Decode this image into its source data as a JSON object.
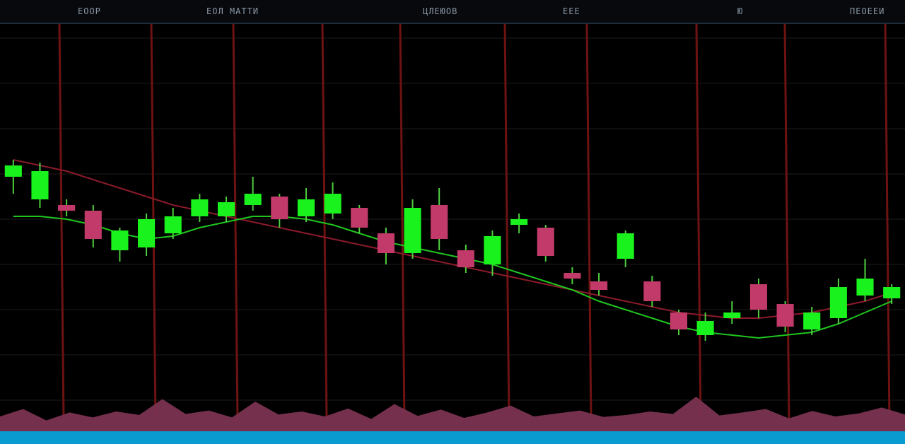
{
  "header": {
    "labels": [
      "ЕООР",
      "ЕОЛ МАТТИ",
      "ЦЛЕЮОВ",
      "ЕЕЕ",
      "Ю",
      "ПЕОЕЕИ"
    ]
  },
  "colors": {
    "background": "#000000",
    "bull": "#19f21c",
    "bear": "#c23a6a",
    "wick": "#4fd03f",
    "ma_fast": "#8b1a2b",
    "ma_slow": "#1fc51f",
    "volume": "#7a3350",
    "vline": "#6e1212",
    "grid": "#1b1b1b",
    "footer": "#0a9bd0"
  },
  "chart_data": {
    "type": "candlestick",
    "title": "",
    "xlabel": "",
    "ylabel": "",
    "ylim": [
      0,
      100
    ],
    "grid": true,
    "candles": [
      {
        "o": 66,
        "c": 70,
        "h": 72,
        "l": 60
      },
      {
        "o": 58,
        "c": 68,
        "h": 71,
        "l": 55
      },
      {
        "o": 56,
        "c": 54,
        "h": 58,
        "l": 52
      },
      {
        "o": 54,
        "c": 44,
        "h": 56,
        "l": 41
      },
      {
        "o": 40,
        "c": 47,
        "h": 48,
        "l": 36
      },
      {
        "o": 41,
        "c": 51,
        "h": 53,
        "l": 38
      },
      {
        "o": 46,
        "c": 52,
        "h": 55,
        "l": 44
      },
      {
        "o": 52,
        "c": 58,
        "h": 60,
        "l": 50
      },
      {
        "o": 52,
        "c": 57,
        "h": 59,
        "l": 50
      },
      {
        "o": 56,
        "c": 60,
        "h": 66,
        "l": 54
      },
      {
        "o": 59,
        "c": 51,
        "h": 60,
        "l": 48
      },
      {
        "o": 52,
        "c": 58,
        "h": 62,
        "l": 50
      },
      {
        "o": 53,
        "c": 60,
        "h": 64,
        "l": 51
      },
      {
        "o": 55,
        "c": 48,
        "h": 56,
        "l": 46
      },
      {
        "o": 46,
        "c": 39,
        "h": 48,
        "l": 35
      },
      {
        "o": 39,
        "c": 55,
        "h": 58,
        "l": 37
      },
      {
        "o": 56,
        "c": 44,
        "h": 62,
        "l": 40
      },
      {
        "o": 40,
        "c": 34,
        "h": 42,
        "l": 32
      },
      {
        "o": 35,
        "c": 45,
        "h": 47,
        "l": 31
      },
      {
        "o": 49,
        "c": 51,
        "h": 53,
        "l": 46
      },
      {
        "o": 48,
        "c": 38,
        "h": 49,
        "l": 36
      },
      {
        "o": 32,
        "c": 30,
        "h": 34,
        "l": 28
      },
      {
        "o": 29,
        "c": 26,
        "h": 32,
        "l": 24
      },
      {
        "o": 37,
        "c": 46,
        "h": 47,
        "l": 34
      },
      {
        "o": 29,
        "c": 22,
        "h": 31,
        "l": 20
      },
      {
        "o": 18,
        "c": 12,
        "h": 19,
        "l": 10
      },
      {
        "o": 10,
        "c": 15,
        "h": 18,
        "l": 8
      },
      {
        "o": 16,
        "c": 18,
        "h": 22,
        "l": 14
      },
      {
        "o": 28,
        "c": 19,
        "h": 30,
        "l": 16
      },
      {
        "o": 21,
        "c": 13,
        "h": 22,
        "l": 11
      },
      {
        "o": 12,
        "c": 18,
        "h": 20,
        "l": 10
      },
      {
        "o": 16,
        "c": 27,
        "h": 30,
        "l": 14
      },
      {
        "o": 24,
        "c": 30,
        "h": 37,
        "l": 22
      },
      {
        "o": 23,
        "c": 27,
        "h": 28,
        "l": 21
      }
    ],
    "ma_fast": [
      72,
      70,
      68,
      65,
      62,
      59,
      56,
      54,
      52,
      50,
      48,
      46,
      44,
      42,
      40,
      38,
      36,
      34,
      32,
      30,
      28,
      26,
      24,
      22,
      20,
      18,
      17,
      16,
      16,
      17,
      18,
      20,
      22,
      25
    ],
    "ma_slow": [
      52,
      52,
      51,
      49,
      46,
      44,
      45,
      48,
      50,
      52,
      52,
      51,
      49,
      46,
      43,
      41,
      39,
      37,
      35,
      32,
      29,
      26,
      22,
      19,
      16,
      13,
      11,
      10,
      9,
      10,
      11,
      14,
      18,
      22
    ],
    "volume": [
      30,
      45,
      22,
      38,
      28,
      40,
      33,
      65,
      35,
      42,
      28,
      60,
      34,
      40,
      30,
      46,
      25,
      55,
      31,
      44,
      27,
      38,
      52,
      30,
      36,
      42,
      29,
      33,
      40,
      35,
      70,
      32,
      38,
      45,
      26,
      41,
      30,
      36,
      48,
      34
    ]
  }
}
